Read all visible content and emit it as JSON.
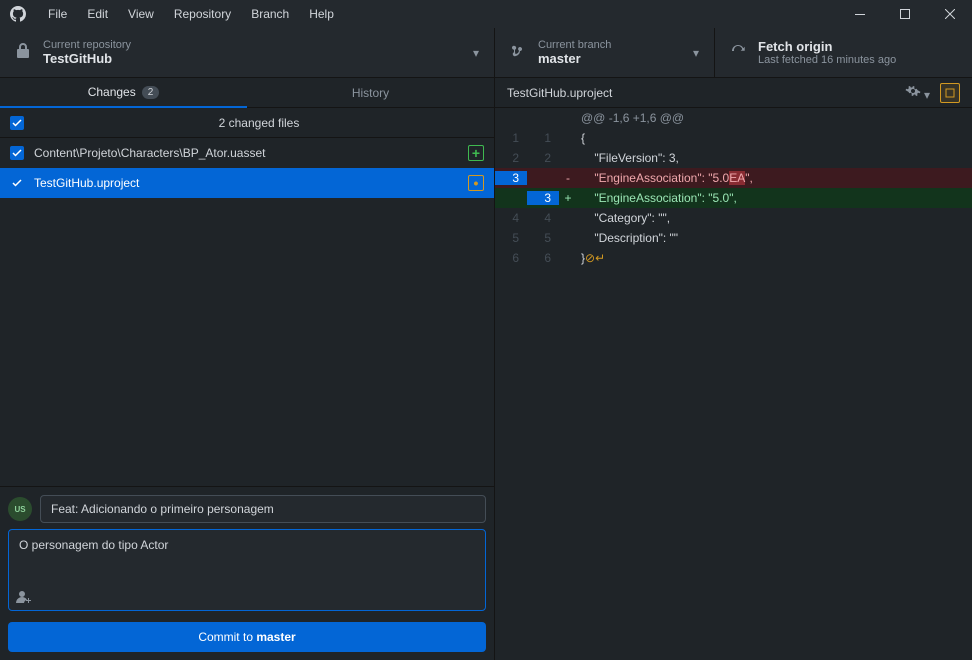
{
  "menu": [
    "File",
    "Edit",
    "View",
    "Repository",
    "Branch",
    "Help"
  ],
  "toolbar": {
    "repo": {
      "label": "Current repository",
      "value": "TestGitHub"
    },
    "branch": {
      "label": "Current branch",
      "value": "master"
    },
    "fetch": {
      "label": "Fetch origin",
      "sub": "Last fetched 16 minutes ago"
    }
  },
  "tabs": {
    "changes": "Changes",
    "changes_count": "2",
    "history": "History"
  },
  "files": {
    "header": "2 changed files",
    "items": [
      {
        "path": "Content\\Projeto\\Characters\\BP_Ator.uasset",
        "status": "added",
        "glyph": "+"
      },
      {
        "path": "TestGitHub.uproject",
        "status": "modified",
        "glyph": "•"
      }
    ],
    "selected_index": 1
  },
  "commit": {
    "summary": "Feat: Adicionando o primeiro personagem",
    "description": "O personagem do tipo Actor",
    "button_prefix": "Commit to ",
    "button_branch": "master"
  },
  "diff": {
    "file": "TestGitHub.uproject",
    "hunk": "@@ -1,6 +1,6 @@",
    "lines": [
      {
        "old": "1",
        "new": "1",
        "type": "ctx",
        "text": "{"
      },
      {
        "old": "2",
        "new": "2",
        "type": "ctx",
        "text": "    \"FileVersion\": 3,"
      },
      {
        "old": "3",
        "new": "",
        "type": "del",
        "text": "    \"EngineAssociation\": \"5.0",
        "hl": "EA",
        "text2": "\","
      },
      {
        "old": "",
        "new": "3",
        "type": "add",
        "text": "    \"EngineAssociation\": \"5.0\","
      },
      {
        "old": "4",
        "new": "4",
        "type": "ctx",
        "text": "    \"Category\": \"\","
      },
      {
        "old": "5",
        "new": "5",
        "type": "ctx",
        "text": "    \"Description\": \"\""
      },
      {
        "old": "6",
        "new": "6",
        "type": "ctx",
        "text": "}",
        "eof": true
      }
    ]
  }
}
